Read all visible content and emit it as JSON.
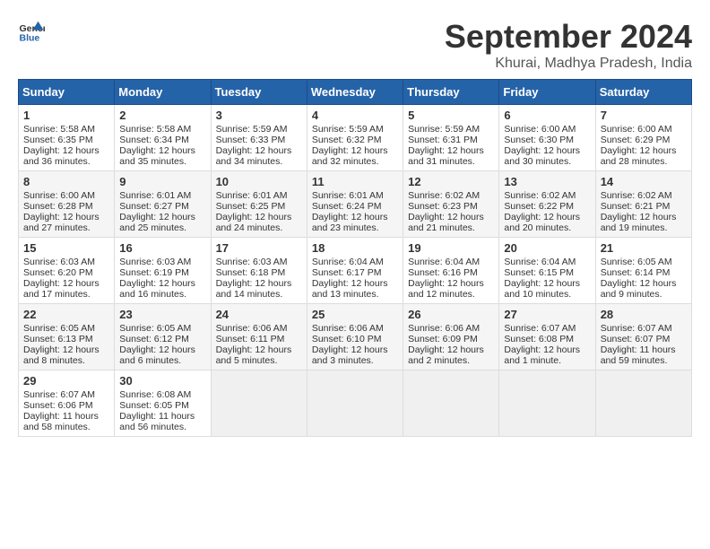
{
  "logo": {
    "line1": "General",
    "line2": "Blue"
  },
  "title": "September 2024",
  "subtitle": "Khurai, Madhya Pradesh, India",
  "headers": [
    "Sunday",
    "Monday",
    "Tuesday",
    "Wednesday",
    "Thursday",
    "Friday",
    "Saturday"
  ],
  "weeks": [
    [
      {
        "day": "1",
        "lines": [
          "Sunrise: 5:58 AM",
          "Sunset: 6:35 PM",
          "Daylight: 12 hours",
          "and 36 minutes."
        ]
      },
      {
        "day": "2",
        "lines": [
          "Sunrise: 5:58 AM",
          "Sunset: 6:34 PM",
          "Daylight: 12 hours",
          "and 35 minutes."
        ]
      },
      {
        "day": "3",
        "lines": [
          "Sunrise: 5:59 AM",
          "Sunset: 6:33 PM",
          "Daylight: 12 hours",
          "and 34 minutes."
        ]
      },
      {
        "day": "4",
        "lines": [
          "Sunrise: 5:59 AM",
          "Sunset: 6:32 PM",
          "Daylight: 12 hours",
          "and 32 minutes."
        ]
      },
      {
        "day": "5",
        "lines": [
          "Sunrise: 5:59 AM",
          "Sunset: 6:31 PM",
          "Daylight: 12 hours",
          "and 31 minutes."
        ]
      },
      {
        "day": "6",
        "lines": [
          "Sunrise: 6:00 AM",
          "Sunset: 6:30 PM",
          "Daylight: 12 hours",
          "and 30 minutes."
        ]
      },
      {
        "day": "7",
        "lines": [
          "Sunrise: 6:00 AM",
          "Sunset: 6:29 PM",
          "Daylight: 12 hours",
          "and 28 minutes."
        ]
      }
    ],
    [
      {
        "day": "8",
        "lines": [
          "Sunrise: 6:00 AM",
          "Sunset: 6:28 PM",
          "Daylight: 12 hours",
          "and 27 minutes."
        ]
      },
      {
        "day": "9",
        "lines": [
          "Sunrise: 6:01 AM",
          "Sunset: 6:27 PM",
          "Daylight: 12 hours",
          "and 25 minutes."
        ]
      },
      {
        "day": "10",
        "lines": [
          "Sunrise: 6:01 AM",
          "Sunset: 6:25 PM",
          "Daylight: 12 hours",
          "and 24 minutes."
        ]
      },
      {
        "day": "11",
        "lines": [
          "Sunrise: 6:01 AM",
          "Sunset: 6:24 PM",
          "Daylight: 12 hours",
          "and 23 minutes."
        ]
      },
      {
        "day": "12",
        "lines": [
          "Sunrise: 6:02 AM",
          "Sunset: 6:23 PM",
          "Daylight: 12 hours",
          "and 21 minutes."
        ]
      },
      {
        "day": "13",
        "lines": [
          "Sunrise: 6:02 AM",
          "Sunset: 6:22 PM",
          "Daylight: 12 hours",
          "and 20 minutes."
        ]
      },
      {
        "day": "14",
        "lines": [
          "Sunrise: 6:02 AM",
          "Sunset: 6:21 PM",
          "Daylight: 12 hours",
          "and 19 minutes."
        ]
      }
    ],
    [
      {
        "day": "15",
        "lines": [
          "Sunrise: 6:03 AM",
          "Sunset: 6:20 PM",
          "Daylight: 12 hours",
          "and 17 minutes."
        ]
      },
      {
        "day": "16",
        "lines": [
          "Sunrise: 6:03 AM",
          "Sunset: 6:19 PM",
          "Daylight: 12 hours",
          "and 16 minutes."
        ]
      },
      {
        "day": "17",
        "lines": [
          "Sunrise: 6:03 AM",
          "Sunset: 6:18 PM",
          "Daylight: 12 hours",
          "and 14 minutes."
        ]
      },
      {
        "day": "18",
        "lines": [
          "Sunrise: 6:04 AM",
          "Sunset: 6:17 PM",
          "Daylight: 12 hours",
          "and 13 minutes."
        ]
      },
      {
        "day": "19",
        "lines": [
          "Sunrise: 6:04 AM",
          "Sunset: 6:16 PM",
          "Daylight: 12 hours",
          "and 12 minutes."
        ]
      },
      {
        "day": "20",
        "lines": [
          "Sunrise: 6:04 AM",
          "Sunset: 6:15 PM",
          "Daylight: 12 hours",
          "and 10 minutes."
        ]
      },
      {
        "day": "21",
        "lines": [
          "Sunrise: 6:05 AM",
          "Sunset: 6:14 PM",
          "Daylight: 12 hours",
          "and 9 minutes."
        ]
      }
    ],
    [
      {
        "day": "22",
        "lines": [
          "Sunrise: 6:05 AM",
          "Sunset: 6:13 PM",
          "Daylight: 12 hours",
          "and 8 minutes."
        ]
      },
      {
        "day": "23",
        "lines": [
          "Sunrise: 6:05 AM",
          "Sunset: 6:12 PM",
          "Daylight: 12 hours",
          "and 6 minutes."
        ]
      },
      {
        "day": "24",
        "lines": [
          "Sunrise: 6:06 AM",
          "Sunset: 6:11 PM",
          "Daylight: 12 hours",
          "and 5 minutes."
        ]
      },
      {
        "day": "25",
        "lines": [
          "Sunrise: 6:06 AM",
          "Sunset: 6:10 PM",
          "Daylight: 12 hours",
          "and 3 minutes."
        ]
      },
      {
        "day": "26",
        "lines": [
          "Sunrise: 6:06 AM",
          "Sunset: 6:09 PM",
          "Daylight: 12 hours",
          "and 2 minutes."
        ]
      },
      {
        "day": "27",
        "lines": [
          "Sunrise: 6:07 AM",
          "Sunset: 6:08 PM",
          "Daylight: 12 hours",
          "and 1 minute."
        ]
      },
      {
        "day": "28",
        "lines": [
          "Sunrise: 6:07 AM",
          "Sunset: 6:07 PM",
          "Daylight: 11 hours",
          "and 59 minutes."
        ]
      }
    ],
    [
      {
        "day": "29",
        "lines": [
          "Sunrise: 6:07 AM",
          "Sunset: 6:06 PM",
          "Daylight: 11 hours",
          "and 58 minutes."
        ]
      },
      {
        "day": "30",
        "lines": [
          "Sunrise: 6:08 AM",
          "Sunset: 6:05 PM",
          "Daylight: 11 hours",
          "and 56 minutes."
        ]
      },
      null,
      null,
      null,
      null,
      null
    ]
  ]
}
